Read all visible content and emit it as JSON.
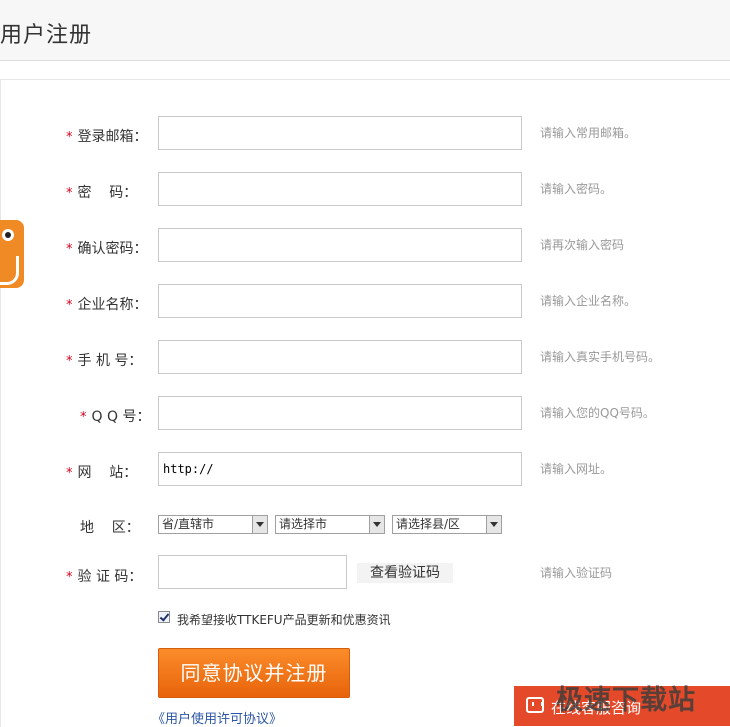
{
  "header": {
    "title": "用户注册"
  },
  "form": {
    "fields": [
      {
        "label": "登录邮箱：",
        "value": "",
        "hint": "请输入常用邮箱。"
      },
      {
        "label": "密    码：",
        "value": "",
        "hint": "请输入密码。"
      },
      {
        "label": "确认密码：",
        "value": "",
        "hint": "请再次输入密码"
      },
      {
        "label": "企业名称：",
        "value": "",
        "hint": "请输入企业名称。"
      },
      {
        "label": "手 机 号：",
        "value": "",
        "hint": "请输入真实手机号码。"
      },
      {
        "label": "Q Q 号：",
        "value": "",
        "hint": "请输入您的QQ号码。"
      },
      {
        "label": "网    站：",
        "value": "http://",
        "hint": "请输入网址。"
      }
    ],
    "region": {
      "label": "地    区：",
      "province": "省/直辖市",
      "city": "请选择市",
      "county": "请选择县/区"
    },
    "captcha": {
      "label": "验 证 码：",
      "value": "",
      "button": "查看验证码",
      "hint": "请输入验证码"
    },
    "required_mark": "*",
    "newsletter": {
      "checked": true,
      "label": "我希望接收TTKEFU产品更新和优惠资讯"
    },
    "submit_label": "同意协议并注册",
    "license": {
      "left_chevron": "《",
      "text": "用户使用许可协议",
      "right_chevron": "》"
    }
  },
  "chat": {
    "label": "在线客服咨询",
    "icon": "chat-bubble-icon"
  },
  "watermark": {
    "text": "极速下载站"
  },
  "side_tab": {
    "icon": "mascot-icon"
  },
  "colors": {
    "accent_orange": "#f08a24",
    "submit_button": "#f07a1c",
    "required_red": "#d0021b",
    "link_blue": "#2a55a6",
    "chat_bar": "#e44a2a"
  }
}
